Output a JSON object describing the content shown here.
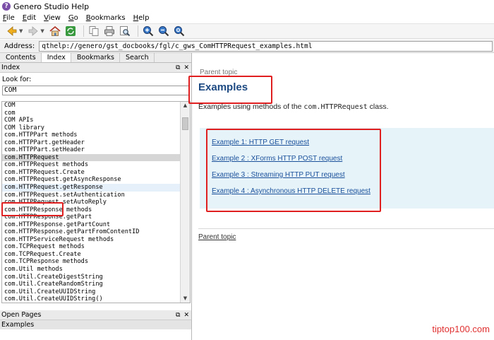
{
  "window": {
    "title": "Genero Studio Help"
  },
  "menu": [
    "File",
    "Edit",
    "View",
    "Go",
    "Bookmarks",
    "Help"
  ],
  "menu_accel": [
    "F",
    "E",
    "V",
    "G",
    "B",
    "H"
  ],
  "toolbar": {
    "icons": [
      "back-icon",
      "forward-icon",
      "home-icon",
      "sync-icon",
      "copy-icon",
      "print-icon",
      "find-icon",
      "zoom-in-icon",
      "zoom-out-icon",
      "zoom-reset-icon"
    ]
  },
  "address": {
    "label": "Address:",
    "value": "qthelp://genero/gst_docbooks/fgl/c_gws_ComHTTPRequest_examples.html"
  },
  "sidebar": {
    "tabs": [
      "Contents",
      "Index",
      "Bookmarks",
      "Search"
    ],
    "active_tab": "Index",
    "index_title": "Index",
    "look_for_label": "Look for:",
    "look_for_value": "COM",
    "items": [
      "COM",
      "com",
      "COM APIs",
      "COM library",
      "com.HTTPPart methods",
      "com.HTTPPart.getHeader",
      "com.HTTPPart.setHeader",
      "com.HTTPRequest",
      "com.HTTPRequest methods",
      "com.HTTPRequest.Create",
      "com.HTTPRequest.getAsyncResponse",
      "com.HTTPRequest.getResponse",
      "com.HTTPRequest.setAuthentication",
      "com.HTTPRequest.setAutoReply",
      "com.HTTPResponse methods",
      "com.HTTPResponse.getPart",
      "com.HTTPResponse.getPartCount",
      "com.HTTPResponse.getPartFromContentID",
      "com.HTTPServiceRequest methods",
      "com.TCPRequest methods",
      "com.TCPRequest.Create",
      "com.TCPResponse methods",
      "com.Util methods",
      "com.Util.CreateDigestString",
      "com.Util.CreateRandomString",
      "com.Util.CreateUUIDString",
      "com.Util.CreateUUIDString()"
    ],
    "selected_index": 7,
    "hover_index": 11,
    "open_pages_title": "Open Pages",
    "open_pages": [
      "Examples"
    ]
  },
  "content": {
    "parent_topic_top": "Parent topic",
    "heading": "Examples",
    "desc_prefix": "Examples using methods of the ",
    "desc_code": "com.HTTPRequest",
    "desc_suffix": " class.",
    "links": [
      "Example 1: HTTP GET request",
      "Example 2 : XForms HTTP POST request",
      "Example 3 : Streaming HTTP PUT request",
      "Example 4 : Asynchronous HTTP DELETE request"
    ],
    "parent_topic_bottom": "Parent topic"
  },
  "watermark": "tiptop100.com",
  "colors": {
    "highlight_red": "#e02020",
    "heading_blue": "#1d4a82",
    "link_blue": "#1a4f9a",
    "example_box": "#e6f4fa"
  }
}
